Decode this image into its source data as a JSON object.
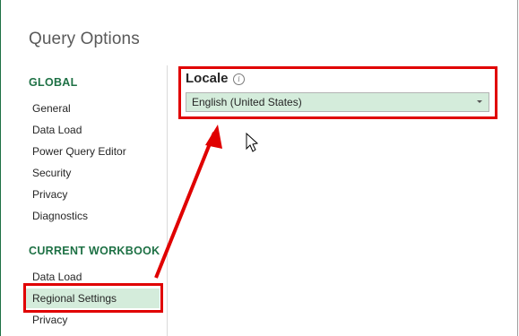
{
  "dialog": {
    "title": "Query Options"
  },
  "sidebar": {
    "global_header": "GLOBAL",
    "global_items": [
      {
        "label": "General"
      },
      {
        "label": "Data Load"
      },
      {
        "label": "Power Query Editor"
      },
      {
        "label": "Security"
      },
      {
        "label": "Privacy"
      },
      {
        "label": "Diagnostics"
      }
    ],
    "workbook_header": "CURRENT WORKBOOK",
    "workbook_items": [
      {
        "label": "Data Load"
      },
      {
        "label": "Regional Settings",
        "selected": true
      },
      {
        "label": "Privacy"
      }
    ]
  },
  "main": {
    "locale_label": "Locale",
    "info_icon": "info-icon",
    "locale_value": "English (United States)"
  },
  "annotation": {
    "color": "#e00000"
  },
  "colors": {
    "accent": "#1e7145",
    "selected_bg": "#d4ecdb"
  }
}
